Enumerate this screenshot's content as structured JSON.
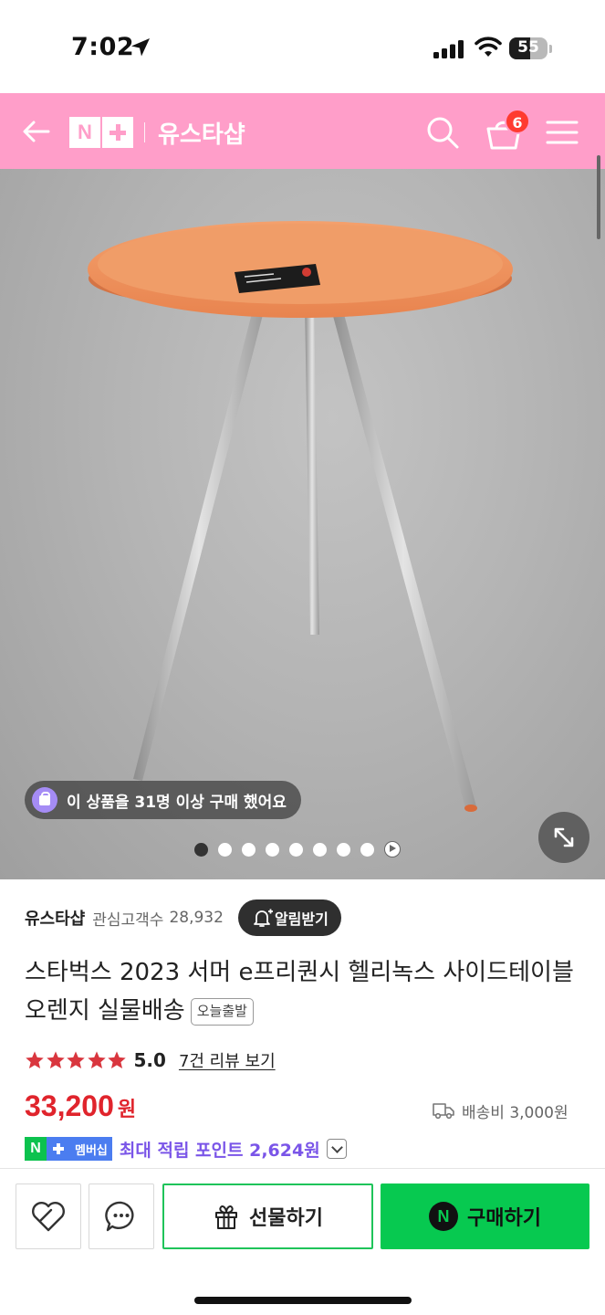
{
  "status_bar": {
    "time": "7:02",
    "battery": "55",
    "battery_level": 0.55
  },
  "header": {
    "logo_letter": "N",
    "shop_name": "유스타샵",
    "cart_count": "6",
    "background_color": "#ff9ec9"
  },
  "gallery": {
    "buyers_notice": "이 상품을 31명 이상 구매 했어요",
    "slide_count": 8,
    "active_slide": 1,
    "has_video": true
  },
  "seller": {
    "name": "유스타샵",
    "fans_label": "관심고객수",
    "fans_count": "28,932",
    "alarm_label": "알림받기"
  },
  "product": {
    "title": "스타벅스 2023 서머 e프리퀀시 헬리녹스 사이드테이블 오렌지 실물배송",
    "badge": "오늘출발",
    "rating": "5.0",
    "stars": 5,
    "review_link": "7건 리뷰 보기",
    "price": "33,200",
    "currency": "원",
    "shipping": "배송비 3,000원",
    "membership_n": "N",
    "membership_label": "멤버십",
    "points_text": "최대 적립 포인트 2,624원"
  },
  "bottom_bar": {
    "gift_label": "선물하기",
    "buy_icon_letter": "N",
    "buy_label": "구매하기"
  },
  "colors": {
    "accent_pink": "#ff9ec9",
    "price_red": "#e0242c",
    "naver_green": "#07c950",
    "points_purple": "#7a55e8",
    "star_red": "#d9363e"
  },
  "icons": [
    "location-arrow-icon",
    "signal-icon",
    "wifi-icon",
    "battery-icon",
    "back-arrow-icon",
    "search-icon",
    "cart-icon",
    "menu-icon",
    "shopping-bag-icon",
    "expand-icon",
    "play-icon",
    "bell-plus-icon",
    "star-icon",
    "truck-icon",
    "chevron-down-icon",
    "heart-icon",
    "chat-bubble-icon",
    "gift-icon",
    "naver-pay-icon"
  ]
}
